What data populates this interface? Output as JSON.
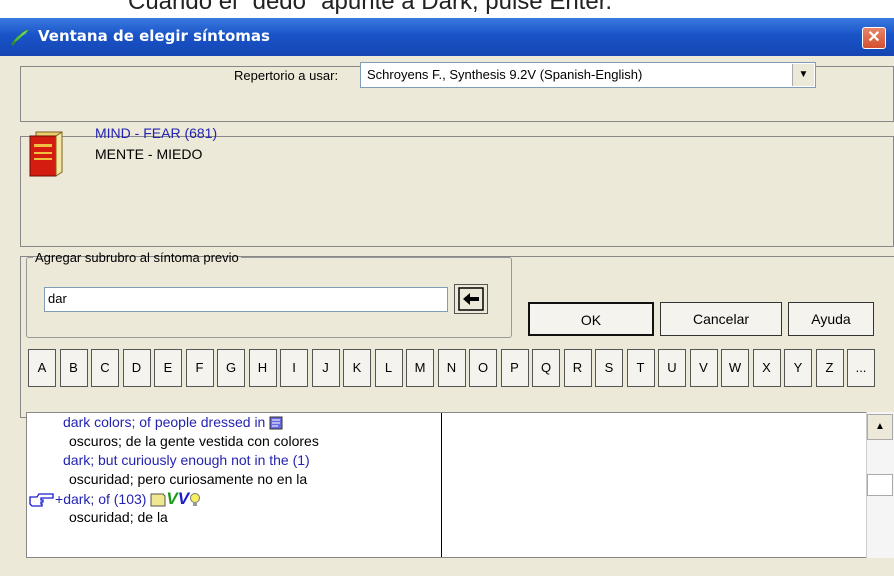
{
  "caption": "Cuando el \"dedo\" apunte a Dark, pulse Enter.",
  "window": {
    "title": "Ventana de elegir síntomas",
    "close_glyph": "✕"
  },
  "repertory": {
    "label": "Repertorio a usar:",
    "selected": "Schroyens F., Synthesis 9.2V (Spanish-English)"
  },
  "rubric": {
    "english": "MIND - FEAR (681)",
    "spanish": "MENTE - MIEDO"
  },
  "subrubric": {
    "legend": "Agregar subrubro al síntoma previo",
    "value": "dar"
  },
  "buttons": {
    "ok": "OK",
    "cancel": "Cancelar",
    "help": "Ayuda"
  },
  "letters": [
    "A",
    "B",
    "C",
    "D",
    "E",
    "F",
    "G",
    "H",
    "I",
    "J",
    "K",
    "L",
    "M",
    "N",
    "O",
    "P",
    "Q",
    "R",
    "S",
    "T",
    "U",
    "V",
    "W",
    "X",
    "Y",
    "Z",
    "..."
  ],
  "results": [
    {
      "en": "dark colors; of people dressed in",
      "es": "oscuros; de la gente vestida con colores"
    },
    {
      "en": "dark; but curiously enough not in the (1)",
      "es": "oscuridad; pero curiosamente no en la"
    },
    {
      "prefix": "+",
      "en": "dark; of (103)",
      "marks": "VV",
      "es": "oscuridad; de la"
    }
  ],
  "icons": {
    "app": "leaf-icon",
    "close": "close-icon",
    "book": "book-icon",
    "pointer": "pointing-hand-icon",
    "arrow": "left-arrow-icon"
  },
  "colors": {
    "titlebar": "#1953c7",
    "link_blue": "#2323b0",
    "marks_green": "#1a9a1a",
    "marks_blue": "#1a1ad0"
  }
}
